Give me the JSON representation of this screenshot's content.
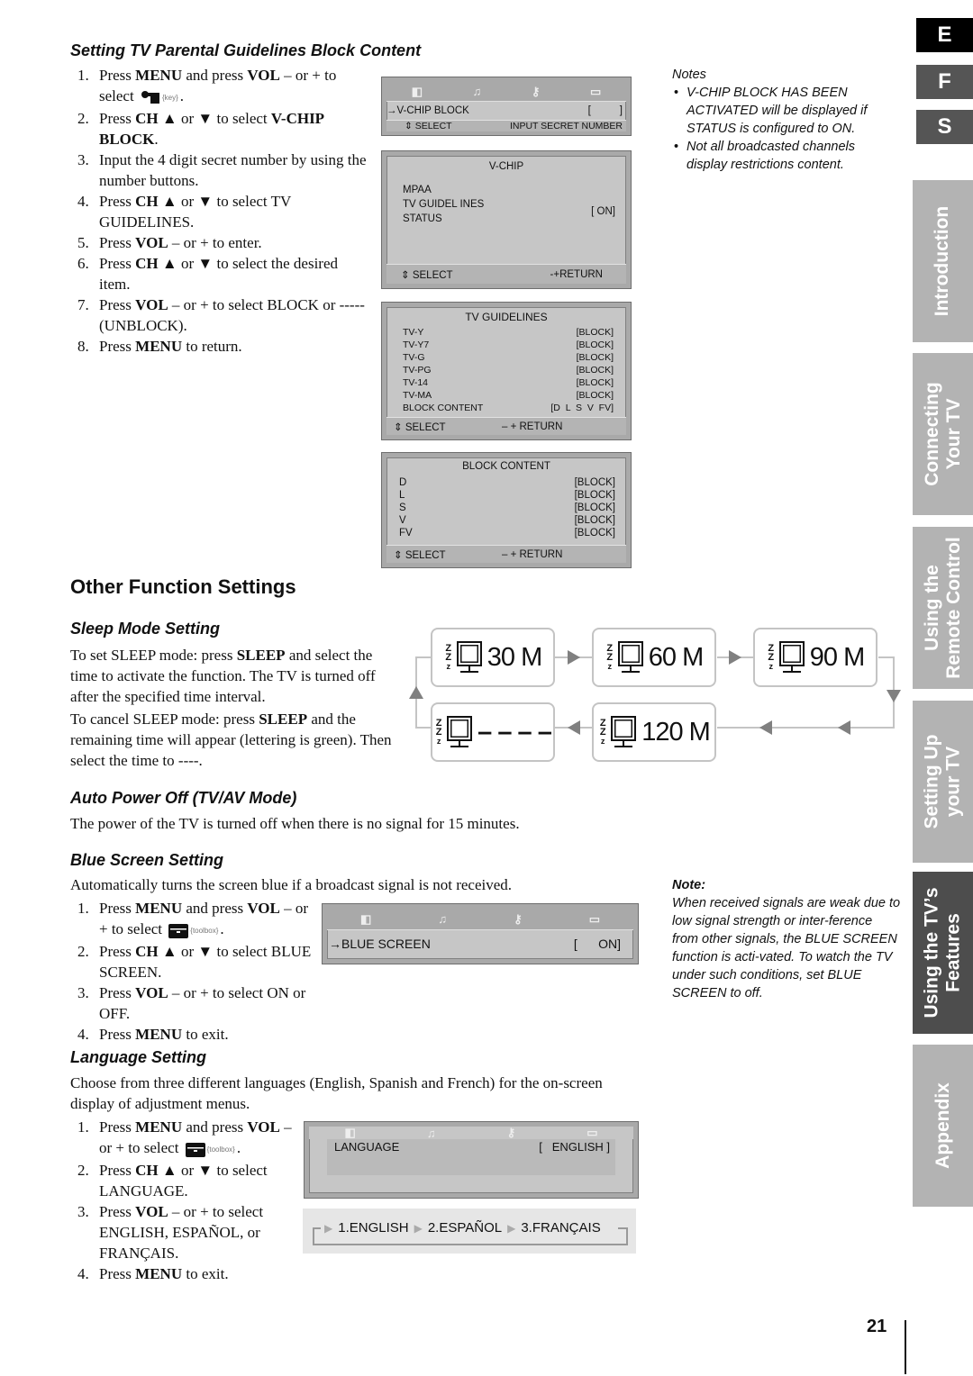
{
  "parental": {
    "heading": "Setting TV Parental Guidelines Block Content",
    "steps": [
      "Press **MENU** and press **VOL** – or + to select {key}.",
      "Press **CH** ▲ or ▼ to select **V-CHIP BLOCK**.",
      "Input the 4 digit secret number by using the number buttons.",
      "Press **CH** ▲ or ▼ to select TV GUIDELINES.",
      "Press **VOL** – or + to enter.",
      "Press **CH** ▲ or ▼ to select the desired item.",
      "Press **VOL** – or + to select BLOCK or -----(UNBLOCK).",
      "Press **MENU** to return."
    ]
  },
  "menus": {
    "vchip_block": {
      "item": "→V-CHIP BLOCK",
      "value": "[          ]",
      "select": "⇕ SELECT",
      "hint": "INPUT SECRET NUMBER"
    },
    "vchip": {
      "title": "V-CHIP",
      "items": [
        "MPAA",
        "TV GUIDEL INES",
        "STATUS"
      ],
      "status": "[ ON]",
      "select": "⇕  SELECT",
      "ret": "-+RETURN"
    },
    "tv_guidelines": {
      "title": "TV GUIDELINES",
      "rows": [
        [
          "TV-Y",
          "[BLOCK]"
        ],
        [
          "TV-Y7",
          "[BLOCK]"
        ],
        [
          "TV-G",
          "[BLOCK]"
        ],
        [
          "TV-PG",
          "[BLOCK]"
        ],
        [
          "TV-14",
          "[BLOCK]"
        ],
        [
          "TV-MA",
          "[BLOCK]"
        ],
        [
          "BLOCK CONTENT",
          "[D  L  S  V  FV]"
        ]
      ],
      "select": "⇕   SELECT",
      "ret": "– + RETURN"
    },
    "block_content": {
      "title": "BLOCK CONTENT",
      "rows": [
        [
          "D",
          "[BLOCK]"
        ],
        [
          "L",
          "[BLOCK]"
        ],
        [
          "S",
          "[BLOCK]"
        ],
        [
          "V",
          "[BLOCK]"
        ],
        [
          "FV",
          "[BLOCK]"
        ]
      ],
      "select": "⇕   SELECT",
      "ret": "– + RETURN"
    },
    "blue_screen": {
      "item": "→BLUE SCREEN",
      "value": "[      ON]"
    },
    "language": {
      "item": "LANGUAGE",
      "value": "[   ENGLISH ]"
    },
    "language_options": [
      "1.ENGLISH",
      "2.ESPAÑOL",
      "3.FRANÇAIS"
    ],
    "icon_names": [
      "picture-icon",
      "music-icon",
      "key-ch-icon",
      "toolbox-icon"
    ]
  },
  "notes": {
    "title": "Notes",
    "items": [
      "V-CHIP BLOCK HAS BEEN ACTIVATED will be displayed if STATUS is configured to ON.",
      "Not all broadcasted channels display restrictions content."
    ]
  },
  "other": {
    "heading": "Other Function Settings",
    "sleep": {
      "heading": "Sleep Mode Setting",
      "p1": "To set SLEEP mode: press **SLEEP** and select the time to activate the function. The TV is turned off after the specified time interval.",
      "p2": "To cancel SLEEP mode: press **SLEEP** and the remaining time will appear (lettering is green). Then select the time to ----.",
      "options": [
        "30 M",
        "60 M",
        "90 M",
        "120 M",
        "– – – –"
      ]
    },
    "auto_off": {
      "heading": "Auto Power Off (TV/AV Mode)",
      "text": "The power of the TV is turned off when there is no signal for 15 minutes."
    },
    "blue": {
      "heading": "Blue Screen Setting",
      "text": "Automatically turns the screen blue if a broadcast signal is not received.",
      "steps": [
        "Press **MENU** and press **VOL** – or + to select {toolbox}.",
        "Press **CH** ▲ or ▼ to select BLUE SCREEN.",
        "Press **VOL** – or + to select ON or OFF.",
        "Press **MENU** to exit."
      ],
      "note_title": "Note:",
      "note": "When received signals are weak due to low signal strength or inter-ference from other signals, the BLUE SCREEN function is acti-vated. To watch the TV under such conditions, set BLUE SCREEN to off."
    },
    "language": {
      "heading": "Language Setting",
      "text": "Choose from three different languages (English, Spanish and French) for the on-screen display of adjustment menus.",
      "steps": [
        "Press **MENU** and press **VOL** – or + to select {toolbox}.",
        "Press **CH** ▲ or ▼ to select LANGUAGE.",
        "Press **VOL** – or + to select ENGLISH, ESPAÑOL, or FRANÇAIS.",
        "Press **MENU** to exit."
      ]
    }
  },
  "sidebar": {
    "languages": [
      "E",
      "F",
      "S"
    ],
    "active_language": "E",
    "tabs": [
      "Introduction",
      "Connecting\nYour TV",
      "Using the\nRemote Control",
      "Setting Up\nyour TV",
      "Using the TV’s\nFeatures",
      "Appendix"
    ],
    "active_tab": 4,
    "tab_color": "#b3b3b3",
    "active_tab_color": "#4d4d4d"
  },
  "page_number": "21"
}
